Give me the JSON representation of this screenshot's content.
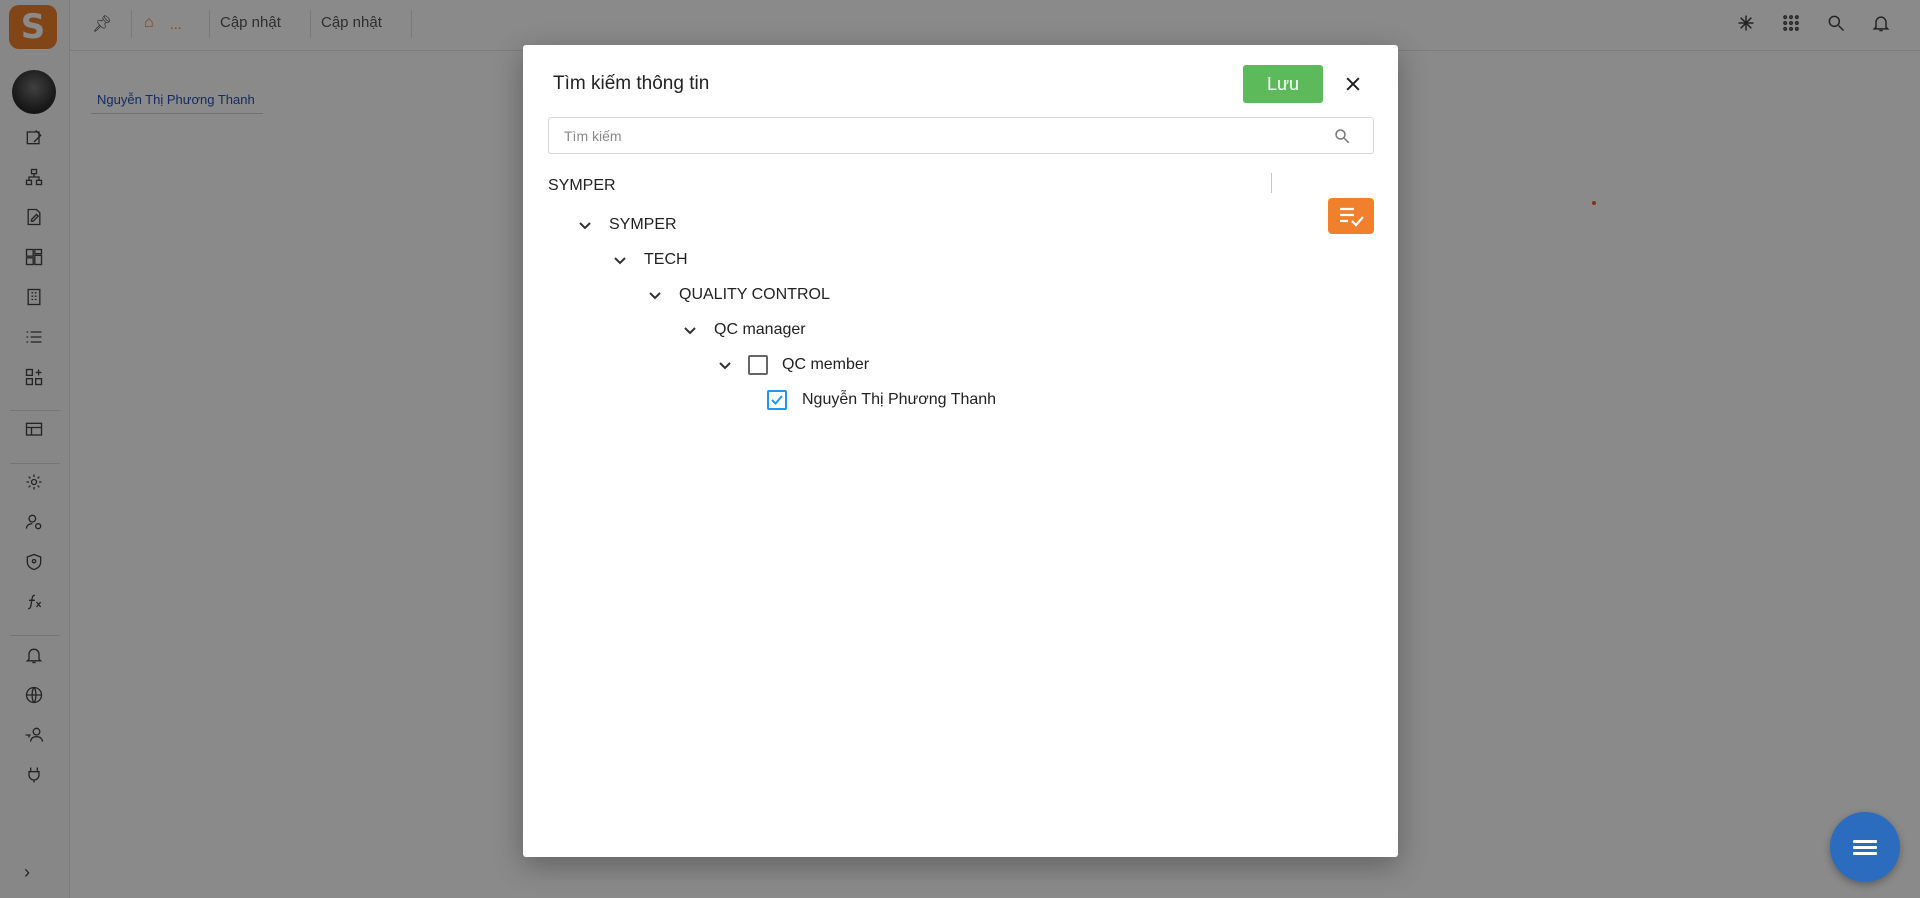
{
  "app": {
    "logo_text": "S",
    "accent_color": "#f0802c"
  },
  "topbar": {
    "breadcrumb_ellipsis": "...",
    "tabs": [
      {
        "label": "Cập nhật"
      },
      {
        "label": "Cập nhật"
      }
    ]
  },
  "background": {
    "user_link": "Nguyễn Thị Phương Thanh"
  },
  "dialog": {
    "title": "Tìm kiếm thông tin",
    "save_label": "Lưu",
    "search_placeholder": "Tìm kiếm",
    "root_label": "SYMPER",
    "tree": [
      {
        "label": "SYMPER",
        "expanded": true,
        "has_checkbox": false
      },
      {
        "label": "TECH",
        "expanded": true,
        "has_checkbox": false
      },
      {
        "label": "QUALITY CONTROL",
        "expanded": true,
        "has_checkbox": false
      },
      {
        "label": "QC manager",
        "expanded": true,
        "has_checkbox": false
      },
      {
        "label": "QC member",
        "expanded": true,
        "has_checkbox": true,
        "checked": false
      },
      {
        "label": "Nguyễn Thị Phương Thanh",
        "expanded": false,
        "has_checkbox": true,
        "checked": true
      }
    ]
  },
  "colors": {
    "save_button": "#5cba5a",
    "select_button": "#f0802c",
    "checkbox_checked": "#2196f3",
    "fab": "#2b6cbf"
  }
}
